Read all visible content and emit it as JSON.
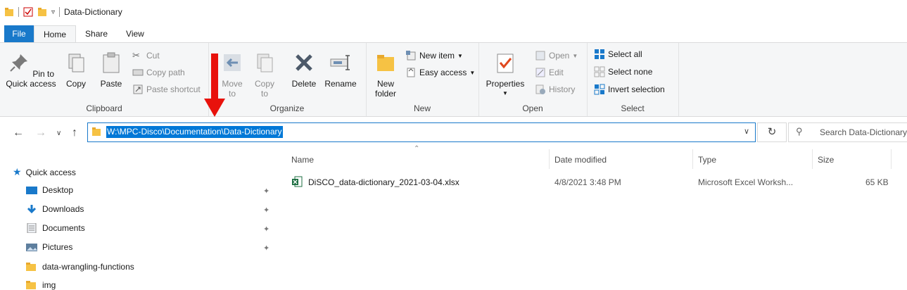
{
  "window": {
    "title": "Data-Dictionary"
  },
  "ribbon_tabs": [
    "File",
    "Home",
    "Share",
    "View"
  ],
  "clipboard": {
    "pin_label": "Pin to Quick access",
    "copy_label": "Copy",
    "paste_label": "Paste",
    "cut_label": "Cut",
    "copy_path_label": "Copy path",
    "paste_shortcut_label": "Paste shortcut",
    "group_label": "Clipboard"
  },
  "organize": {
    "move_to_label": "Move to",
    "copy_to_label": "Copy to",
    "delete_label": "Delete",
    "rename_label": "Rename",
    "group_label": "Organize"
  },
  "new": {
    "new_folder_label": "New folder",
    "new_item_label": "New item",
    "easy_access_label": "Easy access",
    "group_label": "New"
  },
  "open": {
    "properties_label": "Properties",
    "open_label": "Open",
    "edit_label": "Edit",
    "history_label": "History",
    "group_label": "Open"
  },
  "select": {
    "select_all_label": "Select all",
    "select_none_label": "Select none",
    "invert_label": "Invert selection",
    "group_label": "Select"
  },
  "address": {
    "path": "W:\\MPC-Disco\\Documentation\\Data-Dictionary",
    "search_placeholder": "Search Data-Dictionary"
  },
  "columns": {
    "name": "Name",
    "date_modified": "Date modified",
    "type": "Type",
    "size": "Size"
  },
  "files": [
    {
      "name": "DiSCO_data-dictionary_2021-03-04.xlsx",
      "date": "4/8/2021 3:48 PM",
      "type": "Microsoft Excel Worksh...",
      "size": "65 KB"
    }
  ],
  "navpane": {
    "quick_access": "Quick access",
    "items": [
      "Desktop",
      "Downloads",
      "Documents",
      "Pictures",
      "data-wrangling-functions",
      "img"
    ]
  },
  "colors": {
    "accent": "#1979ca",
    "selection": "#0078d7",
    "annotation_arrow": "#e8120c"
  }
}
